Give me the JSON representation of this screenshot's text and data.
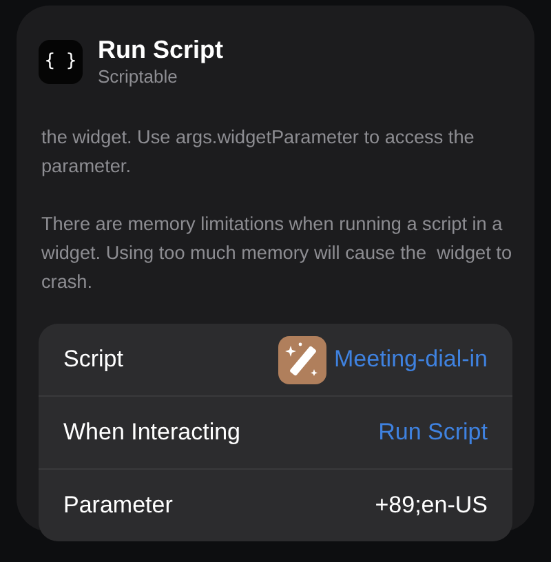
{
  "header": {
    "app_icon_glyph": "{ }",
    "title": "Run Script",
    "subtitle": "Scriptable"
  },
  "description": [
    "the widget. Use args.widgetParameter to access the parameter.",
    "There are memory limitations when running a script in a widget. Using too much memory will cause the  widget to crash."
  ],
  "settings": [
    {
      "kind": "script",
      "label": "Script",
      "value": "Meeting-dial-in"
    },
    {
      "kind": "option",
      "label": "When Interacting",
      "value": "Run Script"
    },
    {
      "kind": "text",
      "label": "Parameter",
      "value": "+89;en-US"
    }
  ]
}
